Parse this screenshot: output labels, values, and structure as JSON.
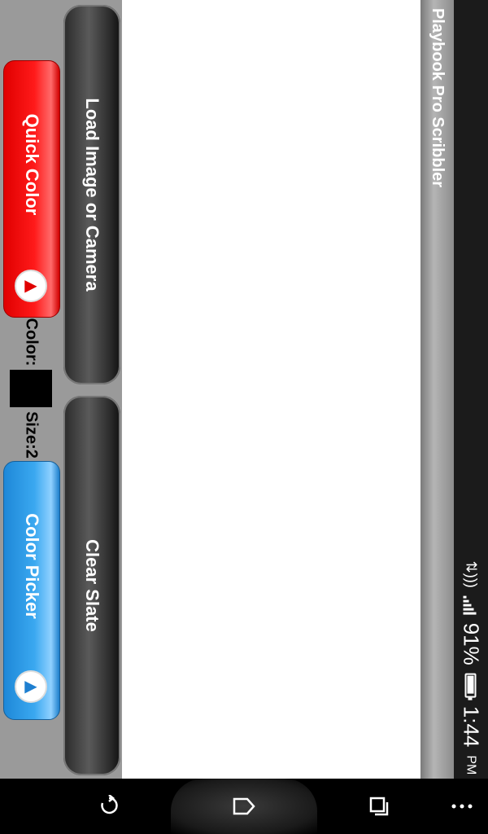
{
  "app": {
    "title": "Playbook Pro Scribbler"
  },
  "toolbar": {
    "load_label": "Load Image or Camera",
    "clear_label": "Clear Slate",
    "quick_color_label": "Quick Color",
    "color_picker_label": "Color Picker",
    "color_label": "Color:",
    "size_label": "Size:2"
  },
  "current": {
    "color": "#000000"
  },
  "status": {
    "time": "1:44",
    "ampm": "PM",
    "battery": "91%"
  },
  "nav": {
    "back_icon": "back-icon",
    "home_icon": "home-icon",
    "recents_icon": "recents-icon",
    "menu_icon": "menu-icon"
  },
  "colors": {
    "quick": "#ff0000",
    "picker": "#2a9be6"
  }
}
